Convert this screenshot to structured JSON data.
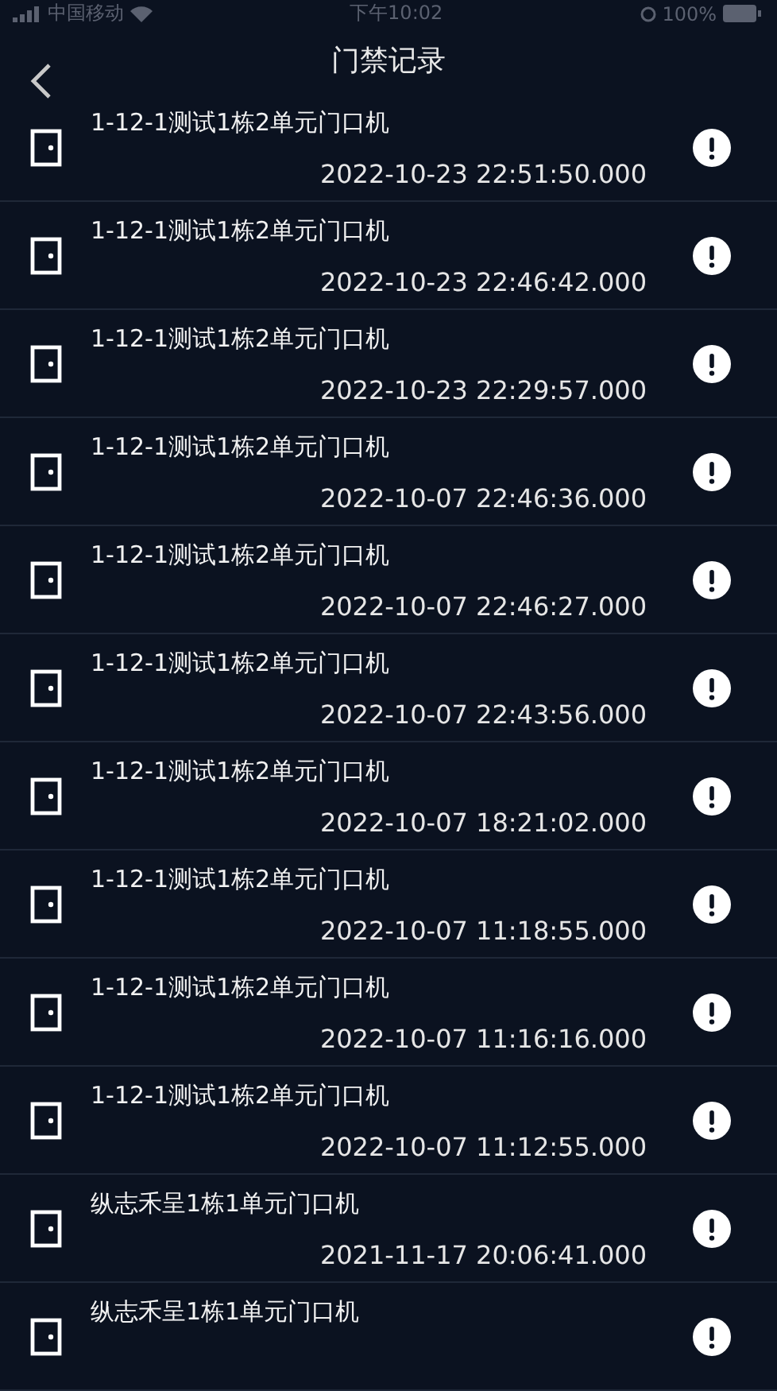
{
  "status_bar": {
    "carrier": "中国移动",
    "time": "下午10:02",
    "battery": "100%"
  },
  "nav": {
    "title": "门禁记录"
  },
  "records": [
    {
      "name": "1-12-1测试1栋2单元门口机",
      "time": "2022-10-23 22:51:50.000"
    },
    {
      "name": "1-12-1测试1栋2单元门口机",
      "time": "2022-10-23 22:46:42.000"
    },
    {
      "name": "1-12-1测试1栋2单元门口机",
      "time": "2022-10-23 22:29:57.000"
    },
    {
      "name": "1-12-1测试1栋2单元门口机",
      "time": "2022-10-07 22:46:36.000"
    },
    {
      "name": "1-12-1测试1栋2单元门口机",
      "time": "2022-10-07 22:46:27.000"
    },
    {
      "name": "1-12-1测试1栋2单元门口机",
      "time": "2022-10-07 22:43:56.000"
    },
    {
      "name": "1-12-1测试1栋2单元门口机",
      "time": "2022-10-07 18:21:02.000"
    },
    {
      "name": "1-12-1测试1栋2单元门口机",
      "time": "2022-10-07 11:18:55.000"
    },
    {
      "name": "1-12-1测试1栋2单元门口机",
      "time": "2022-10-07 11:16:16.000"
    },
    {
      "name": "1-12-1测试1栋2单元门口机",
      "time": "2022-10-07 11:12:55.000"
    },
    {
      "name": "纵志禾呈1栋1单元门口机",
      "time": "2021-11-17 20:06:41.000"
    },
    {
      "name": "纵志禾呈1栋1单元门口机"
    }
  ]
}
